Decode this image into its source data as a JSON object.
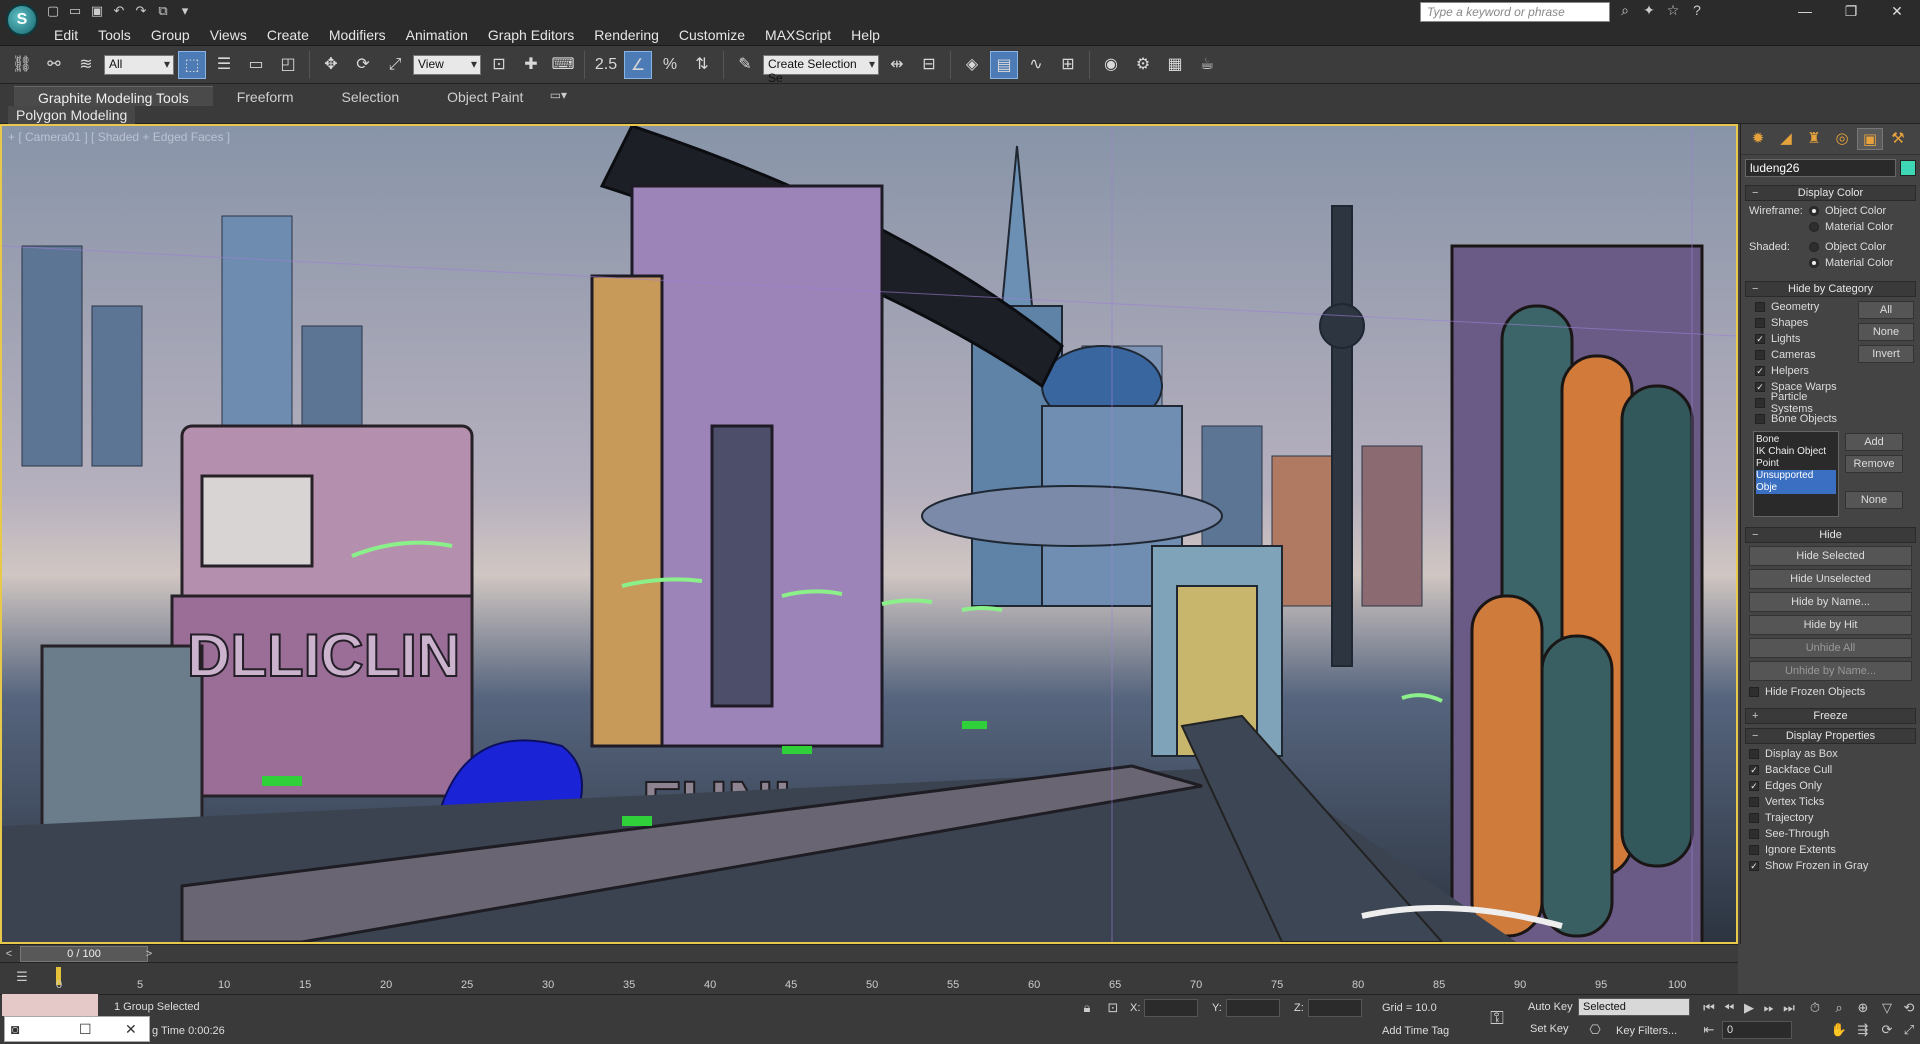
{
  "window": {
    "quick_access": [
      "save-icon",
      "open-icon",
      "undo-icon",
      "redo-icon",
      "hold-icon"
    ],
    "help_search_placeholder": "Type a keyword or phrase",
    "controls": [
      "minimize",
      "maximize",
      "close"
    ]
  },
  "menu": [
    "Edit",
    "Tools",
    "Group",
    "Views",
    "Create",
    "Modifiers",
    "Animation",
    "Graph Editors",
    "Rendering",
    "Customize",
    "MAXScript",
    "Help"
  ],
  "toolbar": {
    "selection_filter": "All",
    "reference_coord": "View",
    "snap_value": "2.5",
    "named_selection": "Create Selection Se"
  },
  "ribbon": {
    "tabs": [
      "Graphite Modeling Tools",
      "Freeform",
      "Selection",
      "Object Paint"
    ],
    "panel_label": "Polygon Modeling"
  },
  "viewport": {
    "label": "+ [ Camera01 ] [ Shaded + Edged Faces ]",
    "sign_text": "DLLICLIN",
    "sign_text2": "FUNI"
  },
  "command_panel": {
    "object_name": "ludeng26",
    "object_color": "#3ed6b4",
    "display_color": {
      "title": "Display Color",
      "wireframe_label": "Wireframe:",
      "shaded_label": "Shaded:",
      "option_object": "Object Color",
      "option_material": "Material Color"
    },
    "hide_by_category": {
      "title": "Hide by Category",
      "items": [
        {
          "label": "Geometry",
          "checked": false
        },
        {
          "label": "Shapes",
          "checked": false
        },
        {
          "label": "Lights",
          "checked": true
        },
        {
          "label": "Cameras",
          "checked": false
        },
        {
          "label": "Helpers",
          "checked": true
        },
        {
          "label": "Space Warps",
          "checked": true
        },
        {
          "label": "Particle Systems",
          "checked": false
        },
        {
          "label": "Bone Objects",
          "checked": false
        }
      ],
      "btn_all": "All",
      "btn_none": "None",
      "btn_invert": "Invert",
      "list": [
        "Bone",
        "IK Chain Object",
        "Point",
        "Unsupported Obje"
      ],
      "btn_add": "Add",
      "btn_remove": "Remove",
      "btn_none2": "None"
    },
    "hide": {
      "title": "Hide",
      "hide_selected": "Hide Selected",
      "hide_unselected": "Hide Unselected",
      "hide_by_name": "Hide by Name...",
      "hide_by_hit": "Hide by Hit",
      "unhide_all": "Unhide All",
      "unhide_by_name": "Unhide by Name...",
      "hide_frozen": "Hide Frozen Objects"
    },
    "freeze_title": "Freeze",
    "display_properties": {
      "title": "Display Properties",
      "items": [
        {
          "label": "Display as Box",
          "checked": false
        },
        {
          "label": "Backface Cull",
          "checked": true
        },
        {
          "label": "Edges Only",
          "checked": true
        },
        {
          "label": "Vertex Ticks",
          "checked": false
        },
        {
          "label": "Trajectory",
          "checked": false
        },
        {
          "label": "See-Through",
          "checked": false
        },
        {
          "label": "Ignore Extents",
          "checked": false
        },
        {
          "label": "Show Frozen in Gray",
          "checked": true
        }
      ]
    }
  },
  "timeline": {
    "slider_text": "0 / 100",
    "ticks": [
      "0",
      "5",
      "10",
      "15",
      "20",
      "25",
      "30",
      "35",
      "40",
      "45",
      "50",
      "55",
      "60",
      "65",
      "70",
      "75",
      "80",
      "85",
      "90",
      "95",
      "100"
    ]
  },
  "status": {
    "selection": "1 Group Selected",
    "time_text": "g Time  0:00:26",
    "x_label": "X:",
    "y_label": "Y:",
    "z_label": "Z:",
    "grid": "Grid = 10.0",
    "add_time_tag": "Add Time Tag",
    "auto_key": "Auto Key",
    "set_key": "Set Key",
    "key_mode": "Selected",
    "key_filters": "Key Filters...",
    "frame": "0"
  }
}
